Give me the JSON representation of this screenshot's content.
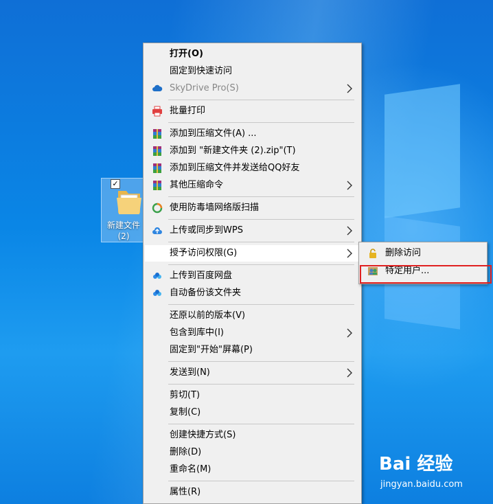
{
  "desktop": {
    "folder_label_line1": "新建文件",
    "folder_label_line2": "(2)",
    "checkbox": "✓"
  },
  "menu": {
    "items": [
      {
        "label": "打开(O)",
        "bold": true
      },
      {
        "label": "固定到快速访问"
      },
      {
        "label": "SkyDrive Pro(S)",
        "disabled": true,
        "icon": "cloud-icon",
        "submenu": true
      },
      {
        "label": "批量打印",
        "icon": "printer-icon"
      },
      {
        "label": "添加到压缩文件(A) ...",
        "icon": "winrar-icon"
      },
      {
        "label": "添加到 \"新建文件夹 (2).zip\"(T)",
        "icon": "winrar-icon"
      },
      {
        "label": "添加到压缩文件并发送给QQ好友",
        "icon": "winrar-icon"
      },
      {
        "label": "其他压缩命令",
        "icon": "winrar-icon",
        "submenu": true
      },
      {
        "label": "使用防毒墙网络版扫描",
        "icon": "antivirus-icon"
      },
      {
        "label": "上传或同步到WPS",
        "icon": "wps-cloud-icon",
        "submenu": true
      },
      {
        "label": "授予访问权限(G)",
        "submenu": true,
        "hover": true
      },
      {
        "label": "上传到百度网盘",
        "icon": "baidu-netdisk-icon"
      },
      {
        "label": "自动备份该文件夹",
        "icon": "baidu-netdisk-icon"
      },
      {
        "label": "还原以前的版本(V)"
      },
      {
        "label": "包含到库中(I)",
        "submenu": true
      },
      {
        "label": "固定到\"开始\"屏幕(P)"
      },
      {
        "label": "发送到(N)",
        "submenu": true
      },
      {
        "label": "剪切(T)"
      },
      {
        "label": "复制(C)"
      },
      {
        "label": "创建快捷方式(S)"
      },
      {
        "label": "删除(D)"
      },
      {
        "label": "重命名(M)"
      },
      {
        "label": "属性(R)"
      }
    ]
  },
  "submenu": {
    "items": [
      {
        "label": "删除访问",
        "icon": "lock-icon"
      },
      {
        "label": "特定用户...",
        "icon": "users-icon"
      }
    ]
  },
  "watermark": {
    "logo": "Bai 经验",
    "url": "jingyan.baidu.com"
  },
  "colors": {
    "menu_bg": "#f0f0f0",
    "highlight_border": "#e02020",
    "desktop_blue": "#0a86e6"
  }
}
